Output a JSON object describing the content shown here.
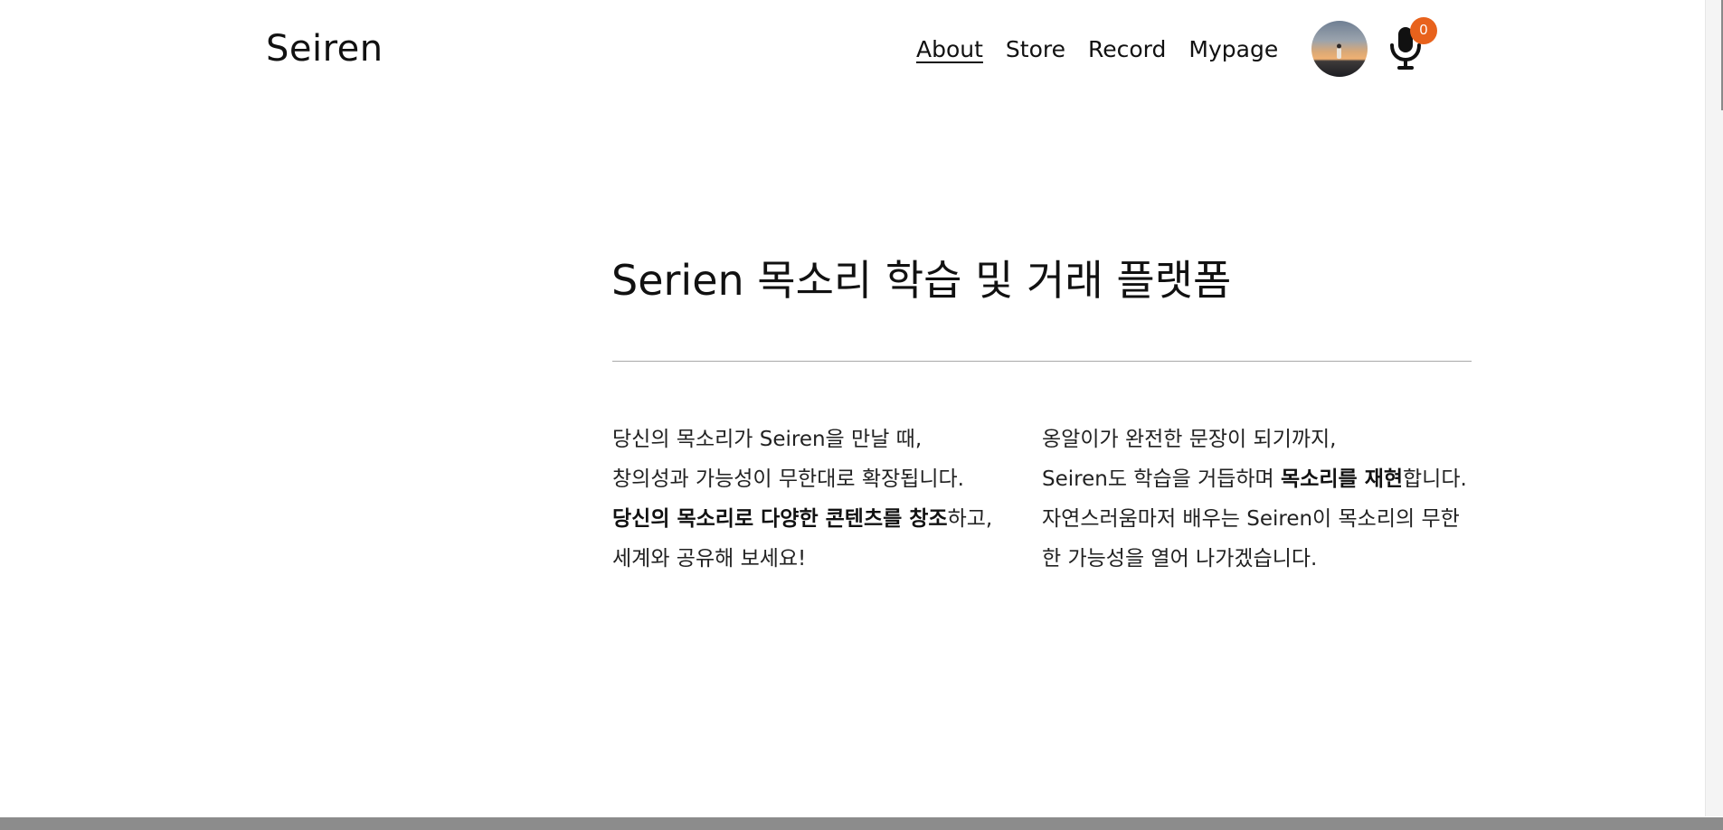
{
  "header": {
    "logo": "Seiren",
    "nav": [
      {
        "label": "About",
        "active": true
      },
      {
        "label": "Store",
        "active": false
      },
      {
        "label": "Record",
        "active": false
      },
      {
        "label": "Mypage",
        "active": false
      }
    ],
    "mic_badge_count": "0",
    "icons": {
      "avatar": "user-avatar",
      "mic": "microphone-icon"
    }
  },
  "main": {
    "title": "Serien 목소리 학습 및 거래 플랫폼",
    "left_column": {
      "line1": "당신의 목소리가 Seiren을 만날 때,",
      "line2": "창의성과 가능성이 무한대로 확장됩니다.",
      "line3_bold": "당신의 목소리로 다양한 콘텐츠를 창조",
      "line3_rest": "하고,",
      "line4": "세계와 공유해 보세요!"
    },
    "right_column": {
      "line1": "옹알이가 완전한 문장이 되기까지,",
      "line2_start": "Seiren도 학습을 거듭하며 ",
      "line2_bold": "목소리를 재현",
      "line2_end": "합니다.",
      "line3": "자연스러움마저 배우는 Seiren이 목소리의 무한",
      "line4": "한 가능성을 열어 나가겠습니다."
    }
  },
  "colors": {
    "accent": "#e8621c",
    "text": "#111111",
    "divider": "#a9a9a9"
  }
}
